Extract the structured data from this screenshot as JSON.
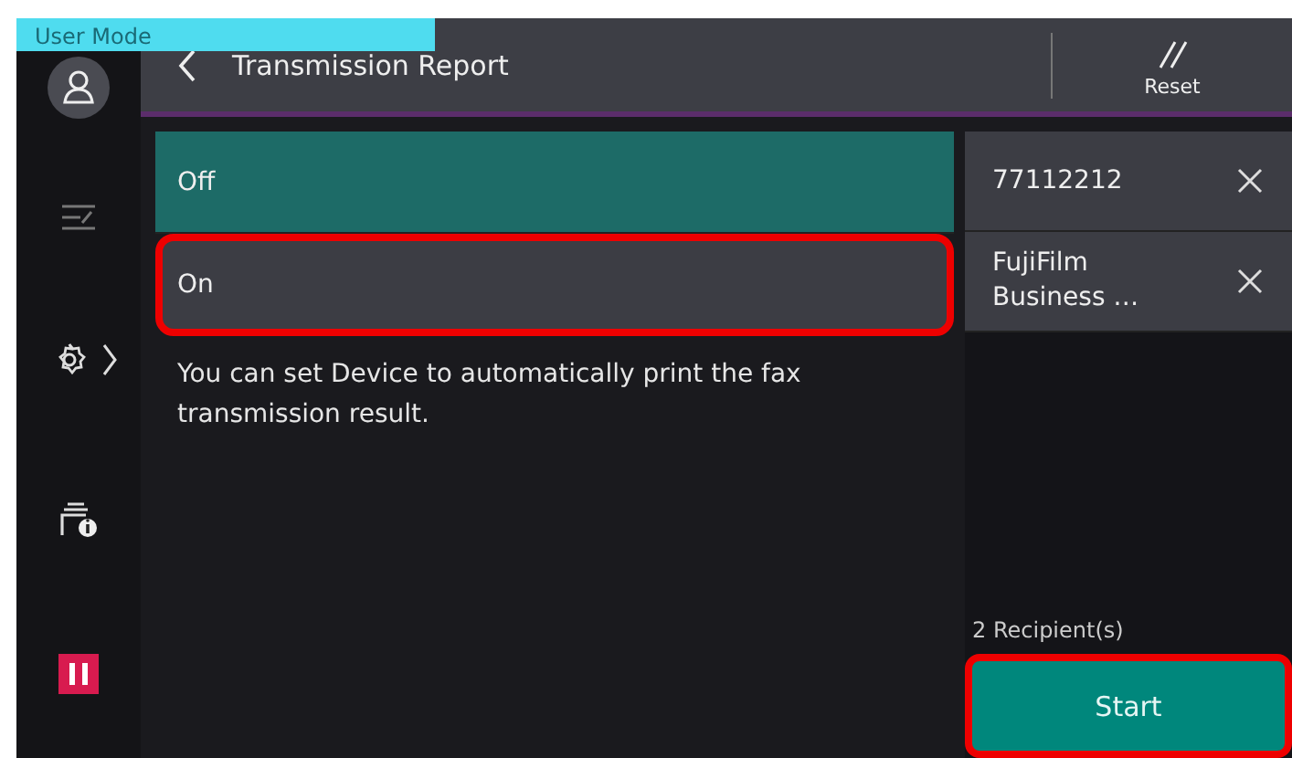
{
  "header": {
    "mode_label": "User Mode",
    "title": "Transmission Report",
    "reset_label": "Reset"
  },
  "options": [
    {
      "label": "Off",
      "selected": true,
      "highlighted": false
    },
    {
      "label": "On",
      "selected": false,
      "highlighted": true
    }
  ],
  "description": "You can set Device to automatically print the fax transmission result.",
  "recipients": [
    {
      "label": "77112212"
    },
    {
      "label": "FujiFilm Business …"
    }
  ],
  "recipient_count": "2 Recipient(s)",
  "start_button": {
    "label": "Start",
    "highlighted": true
  }
}
